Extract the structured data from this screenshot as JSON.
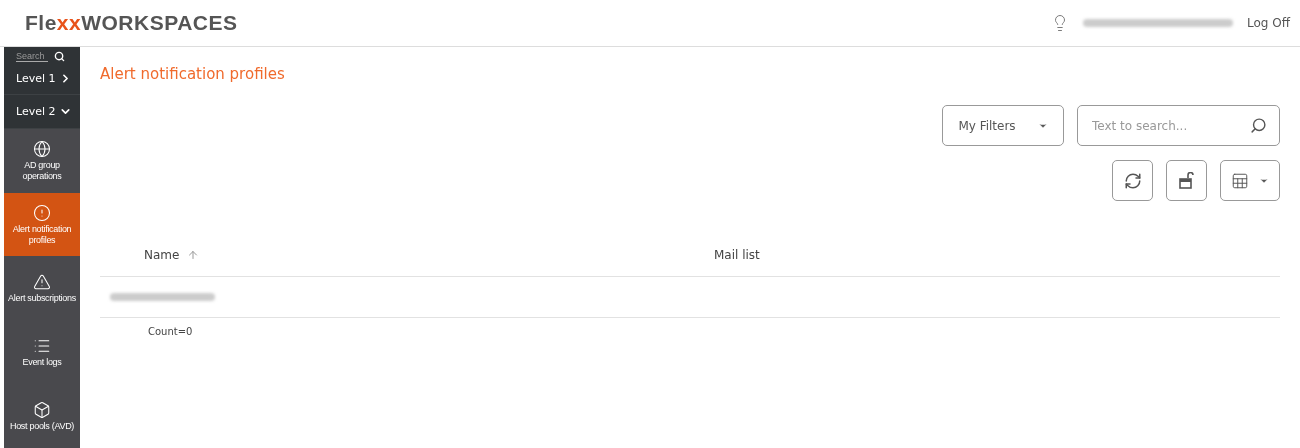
{
  "header": {
    "logo": {
      "prefix": "Fle",
      "mark": "xx",
      "suffix": "WORKSPACES"
    },
    "logoff": "Log Off"
  },
  "sidebar": {
    "search": {
      "placeholder": "Search"
    },
    "levels": [
      {
        "label": "Level 1",
        "expanded": false
      },
      {
        "label": "Level 2",
        "expanded": true
      }
    ],
    "items": [
      {
        "label": "AD group operations",
        "selected": false
      },
      {
        "label": "Alert notification profiles",
        "selected": true
      },
      {
        "label": "Alert subscriptions",
        "selected": false
      },
      {
        "label": "Event logs",
        "selected": false
      },
      {
        "label": "Host pools (AVD)",
        "selected": false
      }
    ]
  },
  "page": {
    "title": "Alert notification profiles"
  },
  "toolbar": {
    "filters": "My Filters",
    "search": {
      "placeholder": "Text to search..."
    }
  },
  "table": {
    "columns": [
      {
        "label": "Name",
        "sorted": true
      },
      {
        "label": "Mail list",
        "sorted": false
      }
    ],
    "count": "Count=0"
  }
}
